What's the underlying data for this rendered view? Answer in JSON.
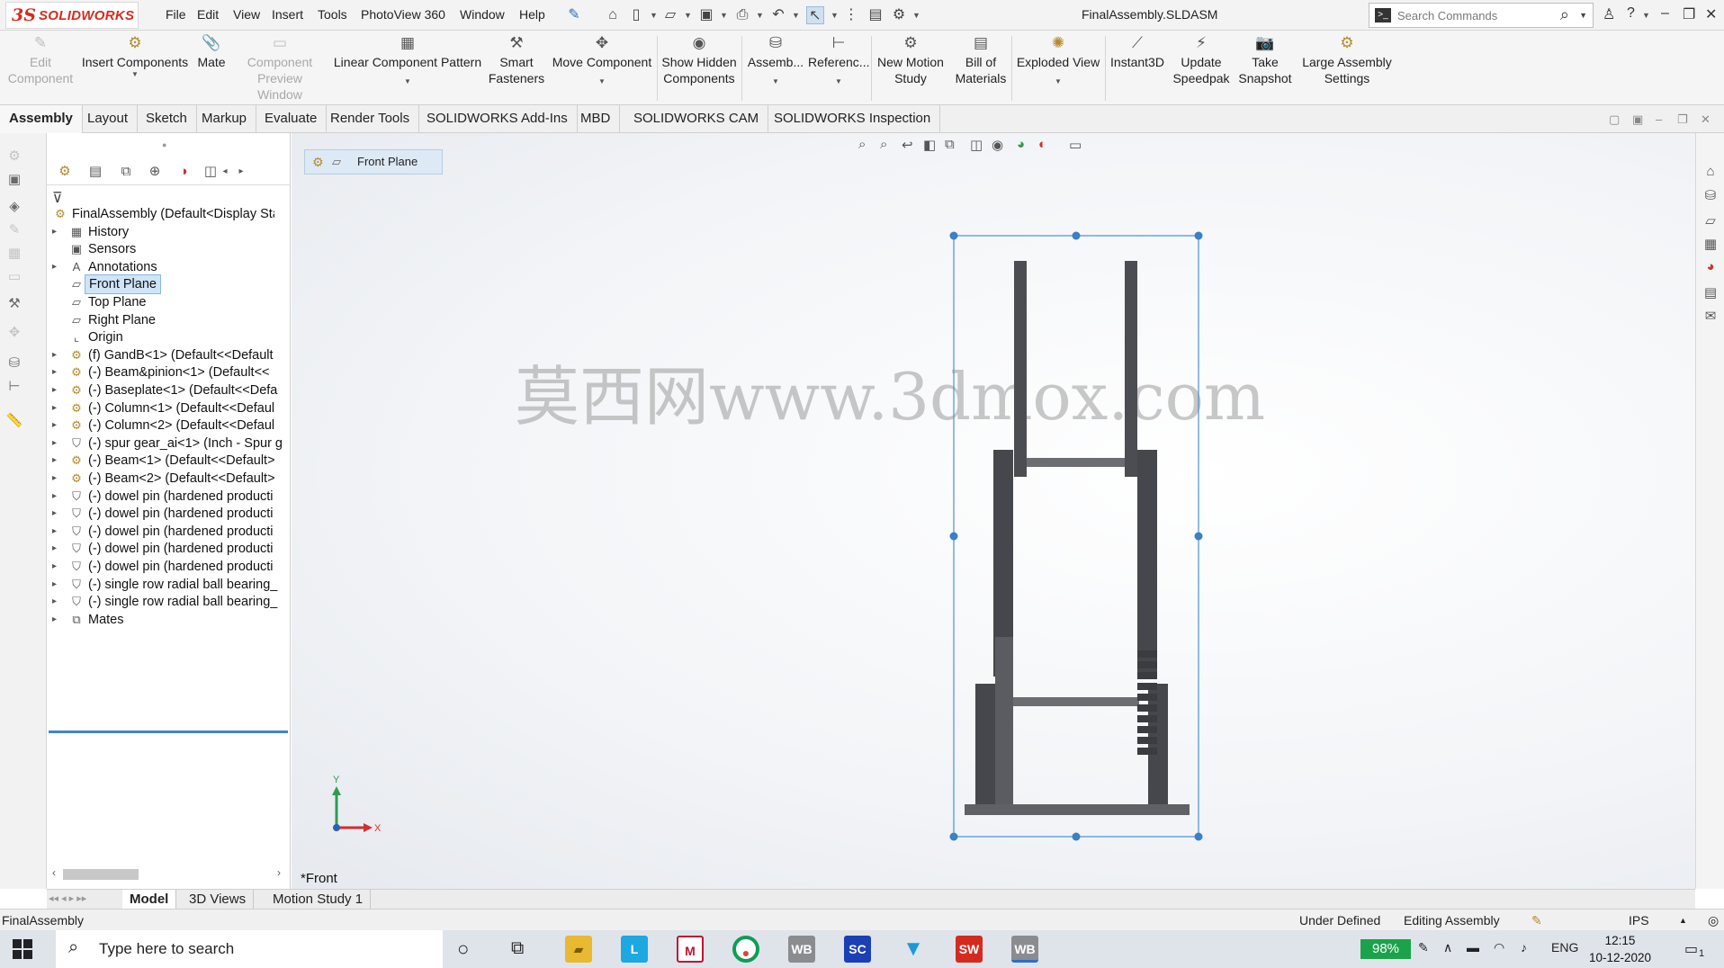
{
  "app": {
    "brand_ds": "3S",
    "brand_name": "SOLIDWORKS",
    "document_title": "FinalAssembly.SLDASM"
  },
  "menu": [
    "File",
    "Edit",
    "View",
    "Insert",
    "Tools",
    "PhotoView 360",
    "Window",
    "Help"
  ],
  "search": {
    "placeholder": "Search Commands"
  },
  "command_manager": {
    "edit_component": "Edit Component",
    "insert_components": "Insert Components",
    "mate": "Mate",
    "component_preview": "Component Preview Window",
    "linear_pattern": "Linear Component Pattern",
    "smart_fasteners": "Smart Fasteners",
    "move_component": "Move Component",
    "show_hidden": "Show Hidden Components",
    "assembly": "Assemb...",
    "reference": "Referenc...",
    "new_motion_study": "New Motion Study",
    "bill_of_materials": "Bill of Materials",
    "exploded_view": "Exploded View",
    "instant3d": "Instant3D",
    "update_speedpak": "Update Speedpak",
    "take_snapshot": "Take Snapshot",
    "large_assembly": "Large Assembly Settings"
  },
  "tabs": [
    "Assembly",
    "Layout",
    "Sketch",
    "Markup",
    "Evaluate",
    "Render Tools",
    "SOLIDWORKS Add-Ins",
    "MBD",
    "SOLIDWORKS CAM",
    "SOLIDWORKS Inspection"
  ],
  "tree": [
    {
      "label": "FinalAssembly  (Default<Display Stat",
      "icon": "assembly-icon",
      "arrow": ""
    },
    {
      "label": "History",
      "icon": "history-icon",
      "arrow": "▸"
    },
    {
      "label": "Sensors",
      "icon": "sensor-icon",
      "arrow": ""
    },
    {
      "label": "Annotations",
      "icon": "annotation-icon",
      "arrow": "▸"
    },
    {
      "label": "Front Plane",
      "icon": "plane-icon",
      "arrow": ""
    },
    {
      "label": "Top Plane",
      "icon": "plane-icon",
      "arrow": ""
    },
    {
      "label": "Right Plane",
      "icon": "plane-icon",
      "arrow": ""
    },
    {
      "label": "Origin",
      "icon": "origin-icon",
      "arrow": ""
    },
    {
      "label": "(f) GandB<1> (Default<<Default",
      "icon": "subassembly-icon",
      "arrow": "▸"
    },
    {
      "label": "(-) Beam&pinion<1> (Default<<",
      "icon": "subassembly-icon",
      "arrow": "▸"
    },
    {
      "label": "(-) Baseplate<1> (Default<<Defa",
      "icon": "subassembly-icon",
      "arrow": "▸"
    },
    {
      "label": "(-) Column<1> (Default<<Defaul",
      "icon": "subassembly-icon",
      "arrow": "▸"
    },
    {
      "label": "(-) Column<2> (Default<<Defaul",
      "icon": "subassembly-icon",
      "arrow": "▸"
    },
    {
      "label": "(-) spur gear_ai<1> (Inch - Spur g",
      "icon": "toolbox-part-icon",
      "arrow": "▸"
    },
    {
      "label": "(-) Beam<1> (Default<<Default>",
      "icon": "subassembly-icon",
      "arrow": "▸"
    },
    {
      "label": "(-) Beam<2> (Default<<Default>",
      "icon": "subassembly-icon",
      "arrow": "▸"
    },
    {
      "label": "(-) dowel pin (hardened producti",
      "icon": "toolbox-part-icon",
      "arrow": "▸"
    },
    {
      "label": "(-) dowel pin (hardened producti",
      "icon": "toolbox-part-icon",
      "arrow": "▸"
    },
    {
      "label": "(-) dowel pin (hardened producti",
      "icon": "toolbox-part-icon",
      "arrow": "▸"
    },
    {
      "label": "(-) dowel pin (hardened producti",
      "icon": "toolbox-part-icon",
      "arrow": "▸"
    },
    {
      "label": "(-) dowel pin (hardened producti",
      "icon": "toolbox-part-icon",
      "arrow": "▸"
    },
    {
      "label": "(-) single row radial ball bearing_",
      "icon": "toolbox-part-icon",
      "arrow": "▸"
    },
    {
      "label": "(-) single row radial ball bearing_",
      "icon": "toolbox-part-icon",
      "arrow": "▸"
    },
    {
      "label": "Mates",
      "icon": "mates-icon",
      "arrow": "▸"
    }
  ],
  "selected_tree_item": "Front Plane",
  "breadcrumb": {
    "label": "Front Plane"
  },
  "watermark": "莫西网www.3dmox.com",
  "viewport": {
    "view_name": "*Front",
    "triad_x": "X",
    "triad_y": "Y"
  },
  "bottom_tabs": [
    "Model",
    "3D Views",
    "Motion Study 1"
  ],
  "status": {
    "left": "FinalAssembly",
    "state": "Under Defined",
    "mode": "Editing Assembly",
    "units": "IPS"
  },
  "taskbar": {
    "search_placeholder": "Type here to search",
    "battery": "98%",
    "language": "ENG",
    "time": "12:15",
    "date": "10-12-2020",
    "notifications": "1",
    "apps": [
      "WB",
      "SC",
      "SW",
      "WB"
    ]
  },
  "colors": {
    "accent": "#3e86c6",
    "brand": "#d52b1e",
    "selection_box": "#4a90d9"
  }
}
